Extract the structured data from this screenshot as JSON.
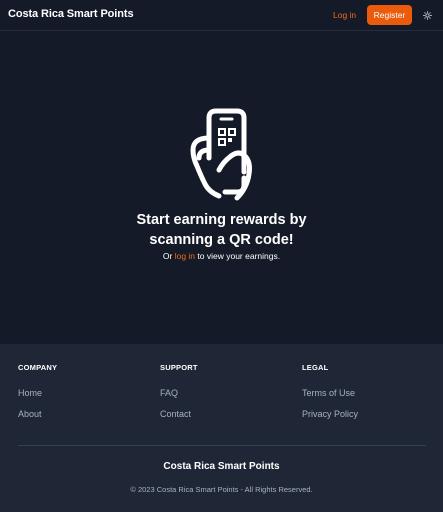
{
  "header": {
    "brand": "Costa Rica Smart Points",
    "login_label": "Log in",
    "register_label": "Register",
    "theme_icon": "sun-icon"
  },
  "hero": {
    "icon": "hand-holding-phone-qr-icon",
    "title_line1": "Start earning rewards by",
    "title_line2": "scanning a QR code!",
    "sub_prefix": "Or ",
    "sub_link": "log in",
    "sub_suffix": " to view your earnings."
  },
  "footer": {
    "columns": [
      {
        "title": "COMPANY",
        "links": [
          "Home",
          "About"
        ]
      },
      {
        "title": "SUPPORT",
        "links": [
          "FAQ",
          "Contact"
        ]
      },
      {
        "title": "LEGAL",
        "links": [
          "Terms of Use",
          "Privacy Policy"
        ]
      }
    ],
    "brand": "Costa Rica Smart Points",
    "copyright": "© 2023 Costa Rica Smart Points - All Rights Reserved."
  },
  "colors": {
    "background": "#141a28",
    "footer_background": "#1f2737",
    "accent": "#ea5b0c",
    "link_accent": "#f26a1b",
    "muted_text": "#a8b1c0"
  }
}
